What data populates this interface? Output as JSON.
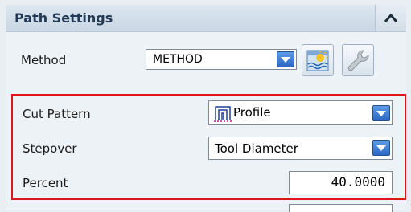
{
  "section": {
    "title": "Path Settings"
  },
  "method": {
    "label": "Method",
    "value": "METHOD"
  },
  "cut_pattern": {
    "label": "Cut Pattern",
    "value": "Profile"
  },
  "stepover": {
    "label": "Stepover",
    "value": "Tool Diameter"
  },
  "percent": {
    "label": "Percent",
    "value": "40.0000"
  },
  "colors": {
    "highlight": "#e0141b",
    "dropdown_arrow": "#2c68c4"
  },
  "icons": {
    "collapse": "chevron-up-icon",
    "method_edit": "display-method-icon",
    "method_wrench": "wrench-icon",
    "cut_pattern": "profile-pattern-icon"
  }
}
